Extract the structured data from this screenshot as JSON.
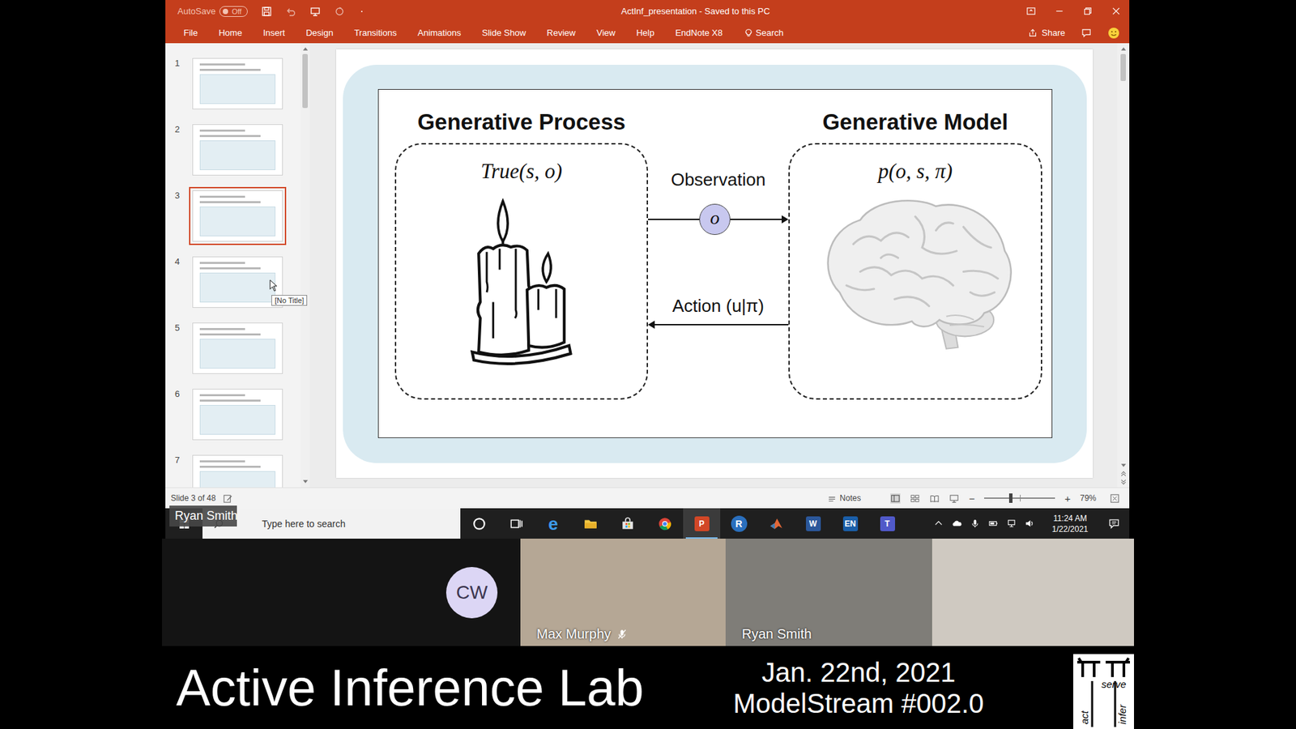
{
  "window": {
    "title": "ActInf_presentation  -  Saved to this PC",
    "autosave": "AutoSave",
    "autosave_state": "Off",
    "autosave_on": false
  },
  "menu": [
    "File",
    "Home",
    "Insert",
    "Design",
    "Transitions",
    "Animations",
    "Slide Show",
    "Review",
    "View",
    "Help",
    "EndNote X8"
  ],
  "search": "Search",
  "share": "Share",
  "thumbnails": [
    {
      "number": "1",
      "selected": false
    },
    {
      "number": "2",
      "selected": false
    },
    {
      "number": "3",
      "selected": true
    },
    {
      "number": "4",
      "selected": false
    },
    {
      "number": "5",
      "selected": false
    },
    {
      "number": "6",
      "selected": false
    },
    {
      "number": "7",
      "selected": false
    }
  ],
  "tooltip": "[No Title]",
  "slide": {
    "process_title": "Generative Process",
    "process_formula": "True(s, o)",
    "model_title": "Generative Model",
    "model_formula": "p(o, s, π)",
    "observation_label": "Observation",
    "observation_symbol": "o",
    "action_label": "Action (u|π)"
  },
  "status_bar": {
    "slide": "Slide 3 of 48",
    "notes": "Notes",
    "zoom_out": "−",
    "zoom_in": "+",
    "zoom": "79%",
    "zoom_level": 0.37
  },
  "taskbar": {
    "search_placeholder": "Type here to search",
    "apps": [
      {
        "kind": "cortana",
        "selected": false
      },
      {
        "kind": "taskview",
        "selected": false
      },
      {
        "kind": "letter-plain",
        "glyph": "e",
        "color": "#3d9be9",
        "selected": false
      },
      {
        "kind": "folder",
        "selected": false
      },
      {
        "kind": "store",
        "selected": false
      },
      {
        "kind": "chrome",
        "selected": false
      },
      {
        "kind": "letter-tile",
        "glyph": "P",
        "color": "#d24726",
        "selected": true
      },
      {
        "kind": "letter-round",
        "glyph": "R",
        "color": "#2a6fbd",
        "selected": false
      },
      {
        "kind": "matlab",
        "selected": false
      },
      {
        "kind": "letter-tile",
        "glyph": "W",
        "color": "#2b579a",
        "selected": false
      },
      {
        "kind": "letter-tile",
        "glyph": "EN",
        "color": "#1a5ea8",
        "selected": false
      },
      {
        "kind": "letter-tile",
        "glyph": "T",
        "color": "#5059c9",
        "selected": false
      }
    ],
    "time": "11:24 AM",
    "date": "1/22/2021"
  },
  "speaker_label": "Ryan Smith",
  "participants": [
    {
      "kind": "avatar",
      "initials": "CW",
      "mic": false
    },
    {
      "kind": "video",
      "name": "Max Murphy",
      "mic": true
    },
    {
      "kind": "video",
      "name": "Ryan Smith",
      "mic": false
    },
    {
      "kind": "video",
      "mic": false
    }
  ],
  "banner": {
    "title": "Active Inference Lab",
    "date": "Jan. 22nd, 2021",
    "episode": "ModelStream #002.0",
    "logo": {
      "top": "serve",
      "left": "act",
      "right": "infer"
    }
  }
}
